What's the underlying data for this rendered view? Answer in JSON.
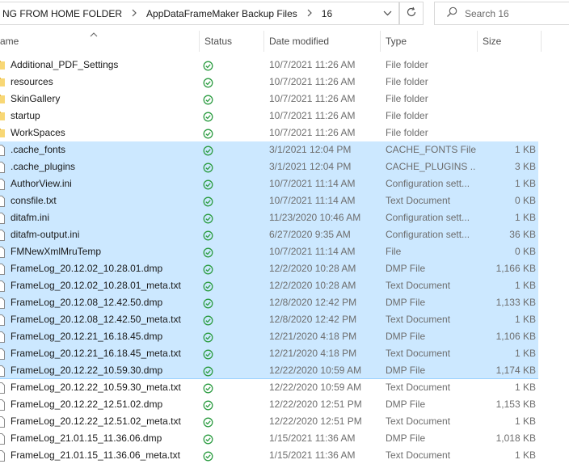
{
  "address_bar": {
    "crumbs": [
      "NG FROM HOME FOLDER",
      "AppDataFrameMaker Backup Files",
      "16"
    ],
    "separator_icon": "chevron-right-icon",
    "dropdown_icon": "chevron-down-icon"
  },
  "refresh_icon": "refresh-icon",
  "search": {
    "placeholder": "Search 16",
    "icon": "search-icon"
  },
  "columns": {
    "name": "ame",
    "status": "Status",
    "date": "Date modified",
    "type": "Type",
    "size": "Size"
  },
  "colors": {
    "selection_bg": "#cce8ff",
    "selection_border": "#99d1ff",
    "folder": "#f8d775",
    "status_green": "#2e9d43"
  },
  "files": [
    {
      "name": "Additional_PDF_Settings",
      "date": "10/7/2021 11:26 AM",
      "type": "File folder",
      "size": "",
      "kind": "folder",
      "selected": false
    },
    {
      "name": "resources",
      "date": "10/7/2021 11:26 AM",
      "type": "File folder",
      "size": "",
      "kind": "folder",
      "selected": false
    },
    {
      "name": "SkinGallery",
      "date": "10/7/2021 11:26 AM",
      "type": "File folder",
      "size": "",
      "kind": "folder",
      "selected": false
    },
    {
      "name": "startup",
      "date": "10/7/2021 11:26 AM",
      "type": "File folder",
      "size": "",
      "kind": "folder",
      "selected": false
    },
    {
      "name": "WorkSpaces",
      "date": "10/7/2021 11:26 AM",
      "type": "File folder",
      "size": "",
      "kind": "folder",
      "selected": false
    },
    {
      "name": ".cache_fonts",
      "date": "3/1/2021 12:04 PM",
      "type": "CACHE_FONTS File",
      "size": "1 KB",
      "kind": "file",
      "selected": true
    },
    {
      "name": ".cache_plugins",
      "date": "3/1/2021 12:04 PM",
      "type": "CACHE_PLUGINS ...",
      "size": "3 KB",
      "kind": "file",
      "selected": true
    },
    {
      "name": "AuthorView.ini",
      "date": "10/7/2021 11:14 AM",
      "type": "Configuration sett...",
      "size": "1 KB",
      "kind": "file",
      "selected": true
    },
    {
      "name": "consfile.txt",
      "date": "10/7/2021 11:14 AM",
      "type": "Text Document",
      "size": "0 KB",
      "kind": "file",
      "selected": true
    },
    {
      "name": "ditafm.ini",
      "date": "11/23/2020 10:46 AM",
      "type": "Configuration sett...",
      "size": "1 KB",
      "kind": "file",
      "selected": true
    },
    {
      "name": "ditafm-output.ini",
      "date": "6/27/2020 9:35 AM",
      "type": "Configuration sett...",
      "size": "36 KB",
      "kind": "file",
      "selected": true
    },
    {
      "name": "FMNewXmlMruTemp",
      "date": "10/7/2021 11:14 AM",
      "type": "File",
      "size": "0 KB",
      "kind": "file",
      "selected": true
    },
    {
      "name": "FrameLog_20.12.02_10.28.01.dmp",
      "date": "12/2/2020 10:28 AM",
      "type": "DMP File",
      "size": "1,166 KB",
      "kind": "file",
      "selected": true
    },
    {
      "name": "FrameLog_20.12.02_10.28.01_meta.txt",
      "date": "12/2/2020 10:28 AM",
      "type": "Text Document",
      "size": "1 KB",
      "kind": "file",
      "selected": true
    },
    {
      "name": "FrameLog_20.12.08_12.42.50.dmp",
      "date": "12/8/2020 12:42 PM",
      "type": "DMP File",
      "size": "1,133 KB",
      "kind": "file",
      "selected": true
    },
    {
      "name": "FrameLog_20.12.08_12.42.50_meta.txt",
      "date": "12/8/2020 12:42 PM",
      "type": "Text Document",
      "size": "1 KB",
      "kind": "file",
      "selected": true
    },
    {
      "name": "FrameLog_20.12.21_16.18.45.dmp",
      "date": "12/21/2020 4:18 PM",
      "type": "DMP File",
      "size": "1,106 KB",
      "kind": "file",
      "selected": true
    },
    {
      "name": "FrameLog_20.12.21_16.18.45_meta.txt",
      "date": "12/21/2020 4:18 PM",
      "type": "Text Document",
      "size": "1 KB",
      "kind": "file",
      "selected": true
    },
    {
      "name": "FrameLog_20.12.22_10.59.30.dmp",
      "date": "12/22/2020 10:59 AM",
      "type": "DMP File",
      "size": "1,174 KB",
      "kind": "file",
      "selected": true
    },
    {
      "name": "FrameLog_20.12.22_10.59.30_meta.txt",
      "date": "12/22/2020 10:59 AM",
      "type": "Text Document",
      "size": "1 KB",
      "kind": "file",
      "selected": false
    },
    {
      "name": "FrameLog_20.12.22_12.51.02.dmp",
      "date": "12/22/2020 12:51 PM",
      "type": "DMP File",
      "size": "1,153 KB",
      "kind": "file",
      "selected": false
    },
    {
      "name": "FrameLog_20.12.22_12.51.02_meta.txt",
      "date": "12/22/2020 12:51 PM",
      "type": "Text Document",
      "size": "1 KB",
      "kind": "file",
      "selected": false
    },
    {
      "name": "FrameLog_21.01.15_11.36.06.dmp",
      "date": "1/15/2021 11:36 AM",
      "type": "DMP File",
      "size": "1,018 KB",
      "kind": "file",
      "selected": false
    },
    {
      "name": "FrameLog_21.01.15_11.36.06_meta.txt",
      "date": "1/15/2021 11:36 AM",
      "type": "Text Document",
      "size": "1 KB",
      "kind": "file",
      "selected": false
    }
  ]
}
